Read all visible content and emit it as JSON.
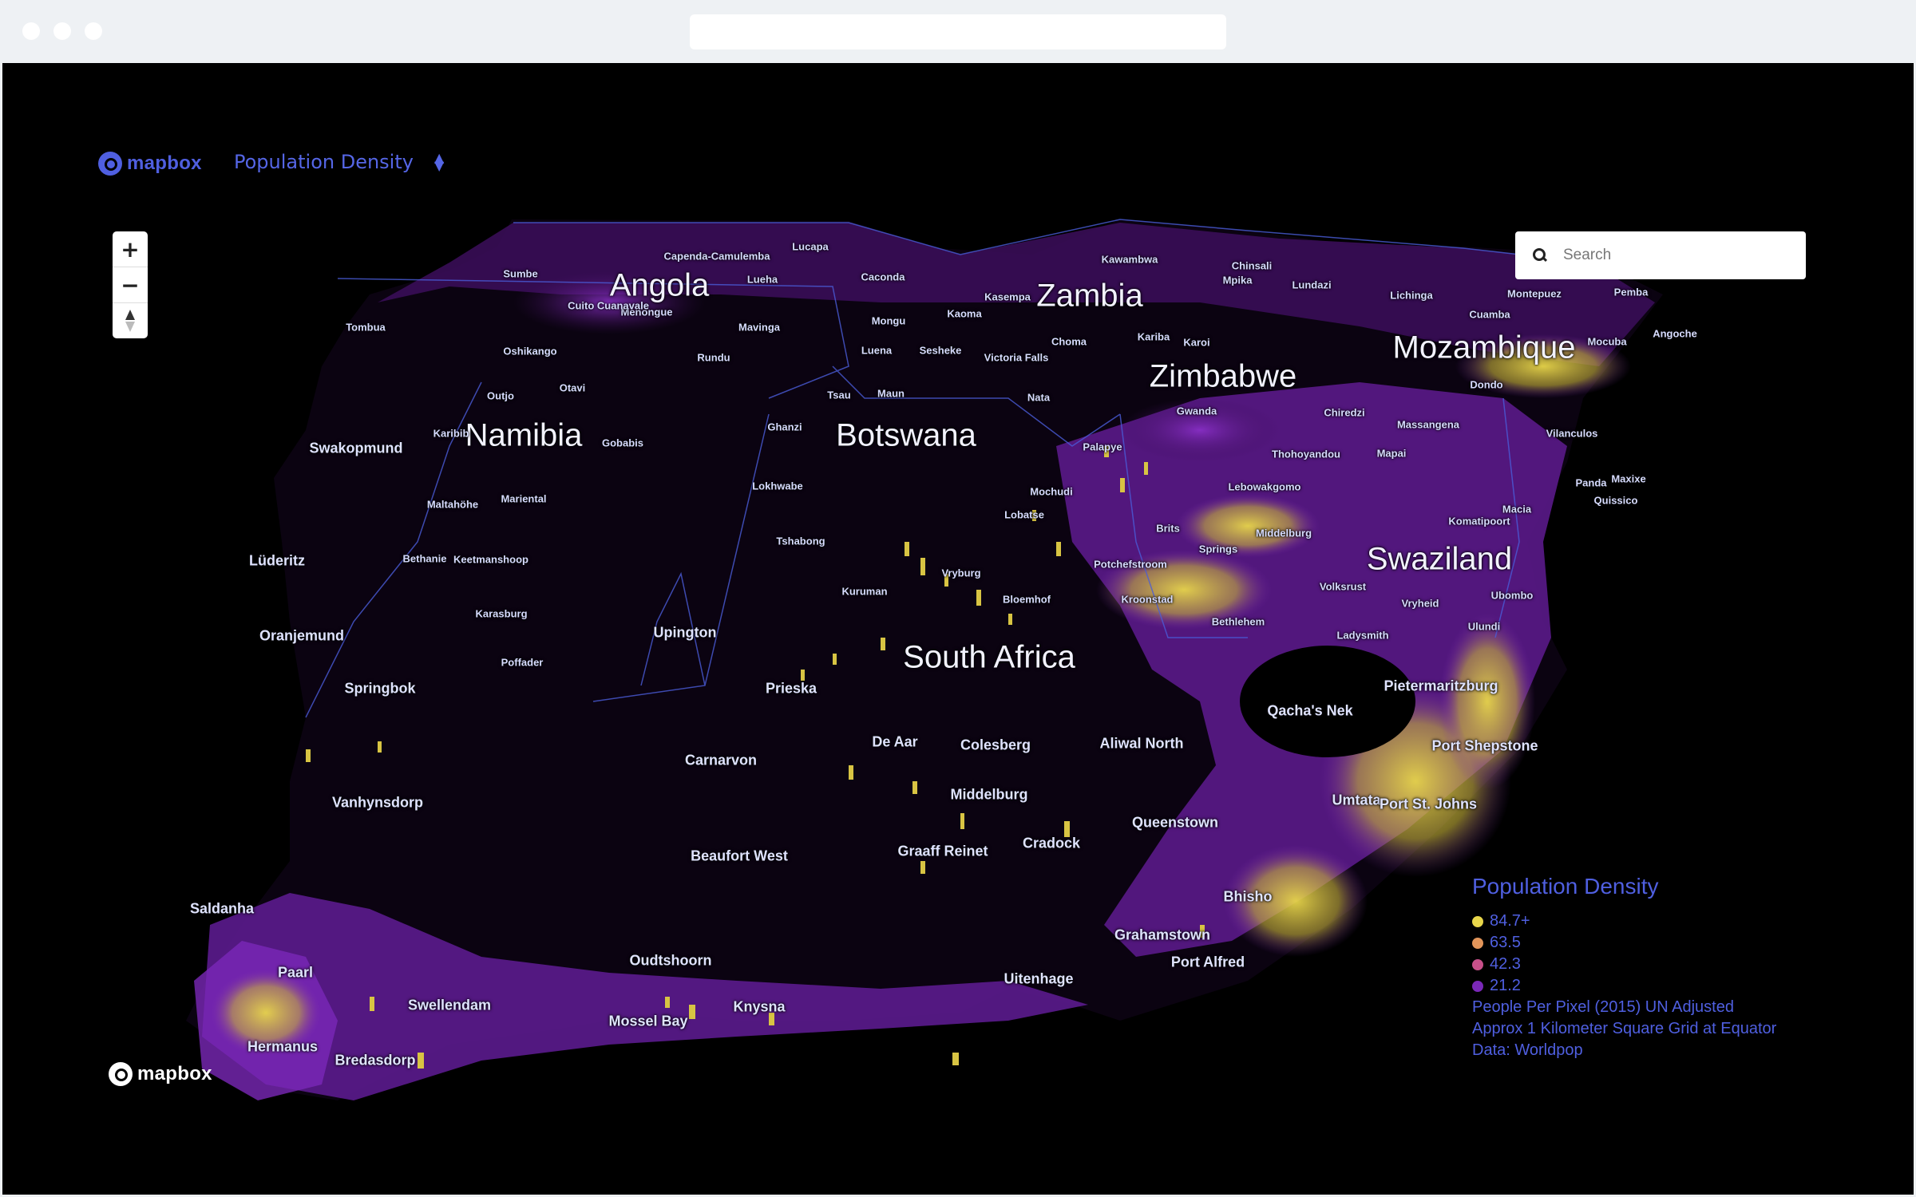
{
  "browser": {
    "window_dots": 3
  },
  "header": {
    "logo_text": "mapbox",
    "layer_select": "Population Density"
  },
  "search": {
    "placeholder": "Search"
  },
  "zoom_controls": {
    "zoom_in": "+",
    "zoom_out": "−"
  },
  "footer_logo_text": "mapbox",
  "countries": [
    "Angola",
    "Zambia",
    "Zimbabwe",
    "Mozambique",
    "Namibia",
    "Botswana",
    "Swaziland",
    "South Africa"
  ],
  "cities": [
    "Swakopmund",
    "Lüderitz",
    "Oranjemund",
    "Springbok",
    "Vanhynsdorp",
    "Saldanha",
    "Paarl",
    "Hermanus",
    "Bredasdorp",
    "Swellendam",
    "Mossel Bay",
    "Knysna",
    "Oudtshoorn",
    "Beaufort West",
    "Uitenhage",
    "Port Alfred",
    "Grahamstown",
    "Bhisho",
    "Cradock",
    "Graaff Reinet",
    "Middelburg",
    "Carnarvon",
    "De Aar",
    "Colesberg",
    "Aliwal North",
    "Queenstown",
    "Umtata",
    "Port St. Johns",
    "Port Shepstone",
    "Pietermaritzburg",
    "Qacha's Nek",
    "Upington",
    "Prieska",
    "Karasburg",
    "Poffader",
    "Bethanie",
    "Keetmanshoop",
    "Maltahöhe",
    "Mariental",
    "Gobabis",
    "Karibib",
    "Outjo",
    "Otavi",
    "Oshikango",
    "Tombua",
    "Tshabong",
    "Kuruman",
    "Vryburg",
    "Bloemhof",
    "Lobatse",
    "Mochudi",
    "Potchefstroom",
    "Kroonstad",
    "Bethlehem",
    "Ladysmith",
    "Vryheid",
    "Volksrust",
    "Ulundi",
    "Ubombo",
    "Springs",
    "Brits",
    "Middelburg",
    "Lebowakgomo",
    "Thohoyandou",
    "Komatipoort",
    "Macia",
    "Maxixe",
    "Quissico",
    "Panda",
    "Vilanculos",
    "Chiredzi",
    "Mapai",
    "Massangena",
    "Dondo",
    "Mocuba",
    "Pemba",
    "Cuamba",
    "Lichinga",
    "Montepuez",
    "Angoche",
    "Gwanda",
    "Palapye",
    "Nata",
    "Maun",
    "Tsau",
    "Ghanzi",
    "Lokhwabe",
    "Rundu",
    "Mavinga",
    "Menongue",
    "Lucapa",
    "Lueha",
    "Luena",
    "Mongu",
    "Kaoma",
    "Sesheke",
    "Victoria Falls",
    "Choma",
    "Kariba",
    "Karoi",
    "Kasempa",
    "Kawambwa",
    "Chinsali",
    "Mpika",
    "Lundazi",
    "Capenda-Camulemba",
    "Sumbe",
    "Cuito Cuanavale",
    "Caconda"
  ],
  "legend": {
    "title": "Population Density",
    "items": [
      {
        "label": "84.7+",
        "color": "#e8d64a"
      },
      {
        "label": "63.5",
        "color": "#e2955a"
      },
      {
        "label": "42.3",
        "color": "#c8508a"
      },
      {
        "label": "21.2",
        "color": "#7a28b8"
      }
    ],
    "notes": [
      "People Per Pixel (2015) UN Adjusted",
      "Approx 1 Kilometer Square Grid at Equator",
      "Data: Worldpop"
    ]
  },
  "colors": {
    "background": "#000000",
    "land_dark": "#0b0311",
    "density_low": "#3a0d55",
    "density_mid": "#7a28b8",
    "density_high": "#e8d64a",
    "accent": "#4f5fe0"
  }
}
